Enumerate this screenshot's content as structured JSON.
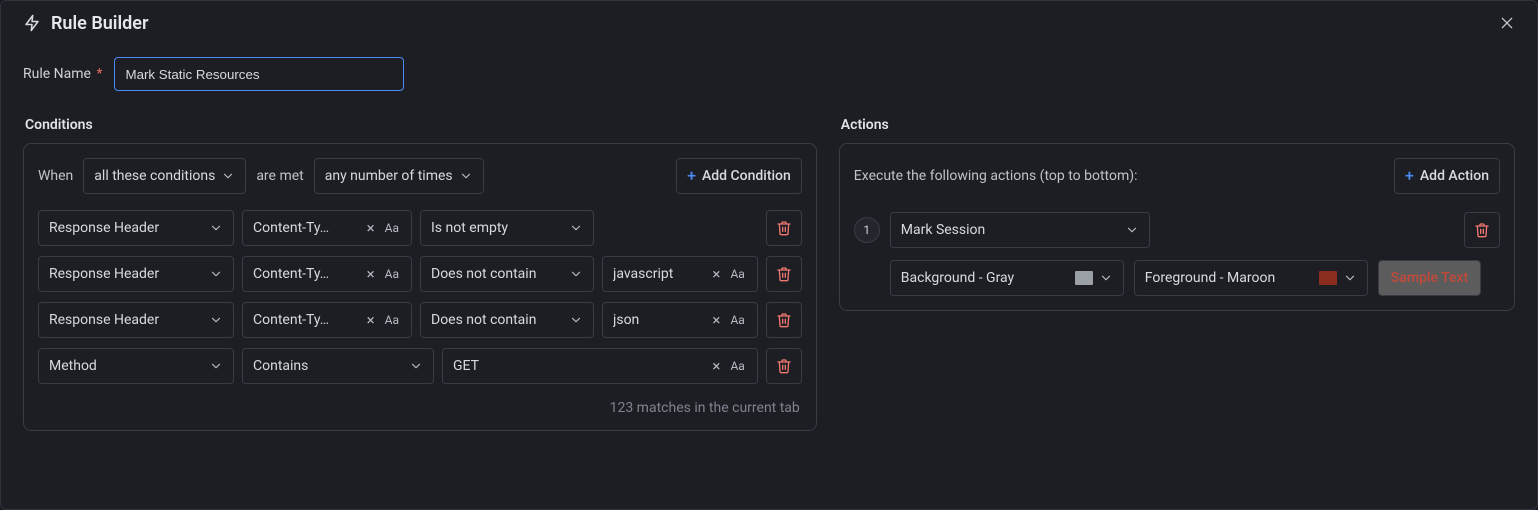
{
  "header": {
    "title": "Rule Builder"
  },
  "rule_name": {
    "label": "Rule Name",
    "value": "Mark Static Resources"
  },
  "conditions": {
    "title": "Conditions",
    "when_label": "When",
    "match_mode": "all these conditions",
    "are_met_label": "are met",
    "frequency": "any number of times",
    "add_condition_label": "Add Condition",
    "match_note": "123 matches in the current tab",
    "rows": [
      {
        "field": "Response Header",
        "key": "Content-Ty…",
        "operator": "Is not empty",
        "value": null
      },
      {
        "field": "Response Header",
        "key": "Content-Ty…",
        "operator": "Does not contain",
        "value": "javascript"
      },
      {
        "field": "Response Header",
        "key": "Content-Ty…",
        "operator": "Does not contain",
        "value": "json"
      },
      {
        "field": "Method",
        "key": null,
        "operator": "Contains",
        "value": "GET"
      }
    ]
  },
  "actions": {
    "title": "Actions",
    "intro": "Execute the following actions (top to bottom):",
    "add_action_label": "Add Action",
    "items": [
      {
        "order": "1",
        "action": "Mark Session",
        "background_label": "Background - Gray",
        "foreground_label": "Foreground - Maroon",
        "sample_label": "Sample Text"
      }
    ]
  },
  "icons": {
    "aa": "Aa"
  }
}
